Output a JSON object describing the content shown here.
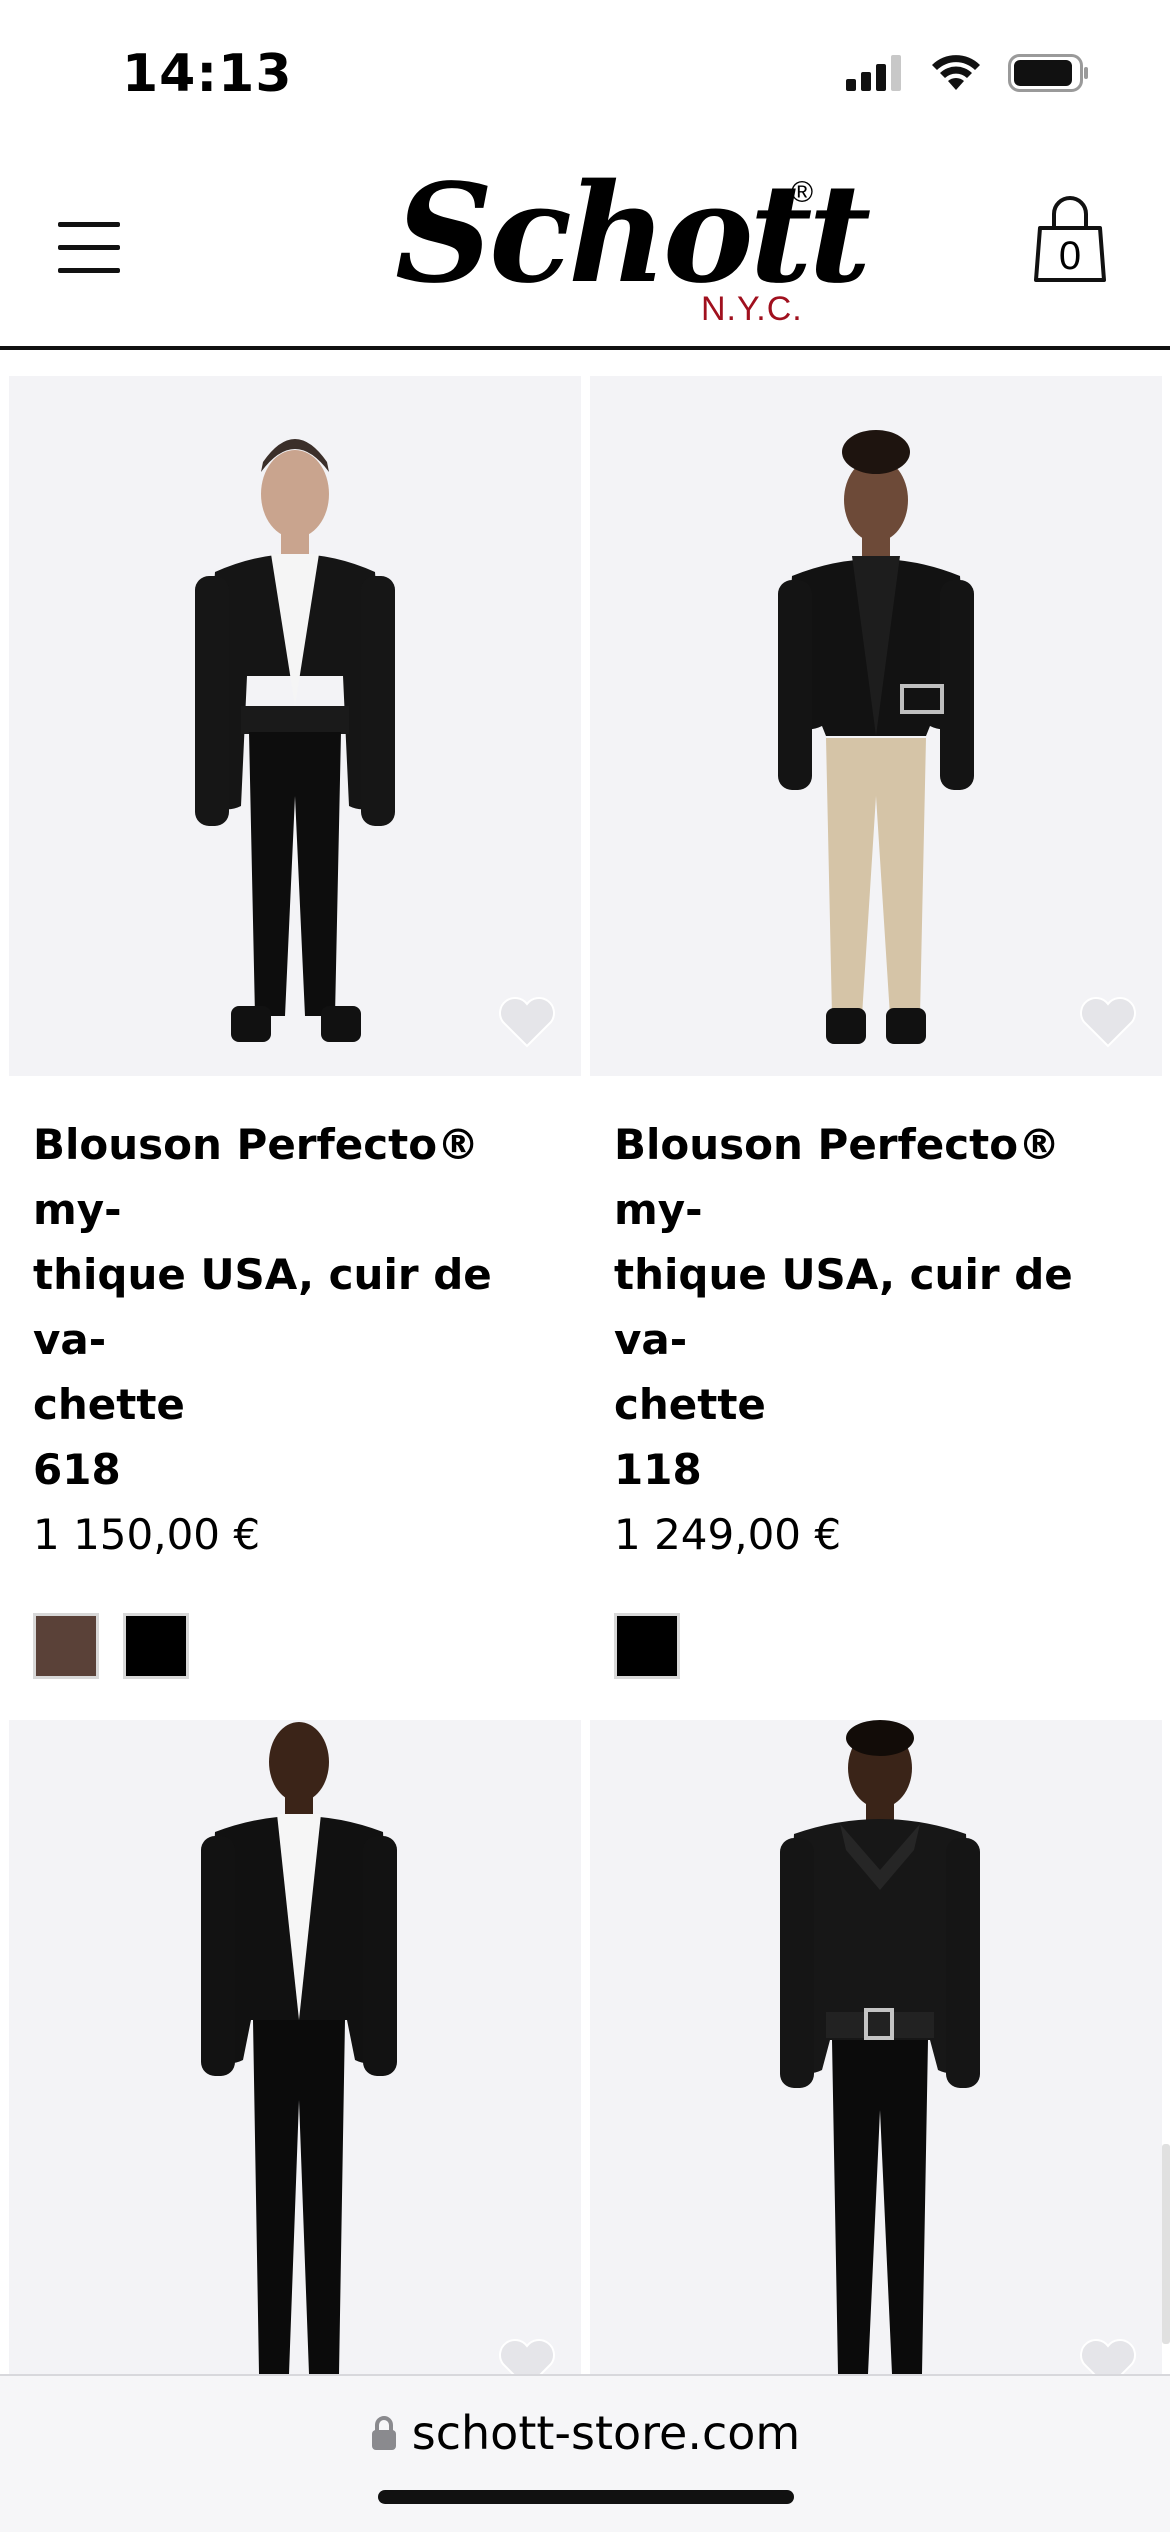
{
  "status_bar": {
    "time": "14:13"
  },
  "header": {
    "brand": "Schott",
    "brand_mark": "®",
    "brand_sub": "N.Y.C.",
    "cart_count": "0",
    "menu_icon": "hamburger-icon",
    "cart_icon": "shopping-bag-icon"
  },
  "products": [
    {
      "title_lines": [
        "Blouson Perfecto® my-",
        "thique USA, cuir de va-",
        "chette"
      ],
      "model": "618",
      "price": "1 150,00 €",
      "colors": [
        "#5a4138",
        "#000000"
      ],
      "wishlist_icon": "heart-icon"
    },
    {
      "title_lines": [
        "Blouson Perfecto® my-",
        "thique USA, cuir de va-",
        "chette"
      ],
      "model": "118",
      "price": "1 249,00 €",
      "colors": [
        "#000000"
      ],
      "wishlist_icon": "heart-icon"
    },
    {
      "wishlist_icon": "heart-icon"
    },
    {
      "wishlist_icon": "heart-icon"
    }
  ],
  "browser": {
    "url": "schott-store.com",
    "lock_icon": "lock-icon"
  }
}
